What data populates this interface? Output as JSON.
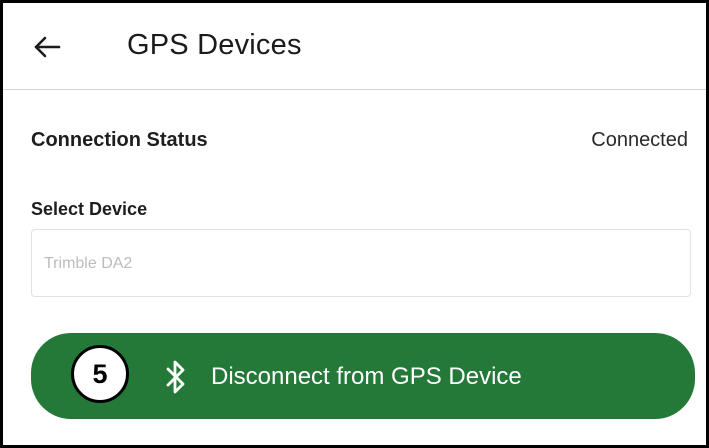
{
  "header": {
    "back_icon": "arrow-left-icon",
    "title": "GPS Devices"
  },
  "connection": {
    "label": "Connection Status",
    "value": "Connected"
  },
  "device_select": {
    "label": "Select Device",
    "value": "Trimble DA2"
  },
  "action_button": {
    "badge": "5",
    "icon": "bluetooth-icon",
    "label": "Disconnect from GPS Device"
  },
  "colors": {
    "primary": "#247838",
    "frame": "#000000",
    "divider": "#d6d6d6"
  }
}
